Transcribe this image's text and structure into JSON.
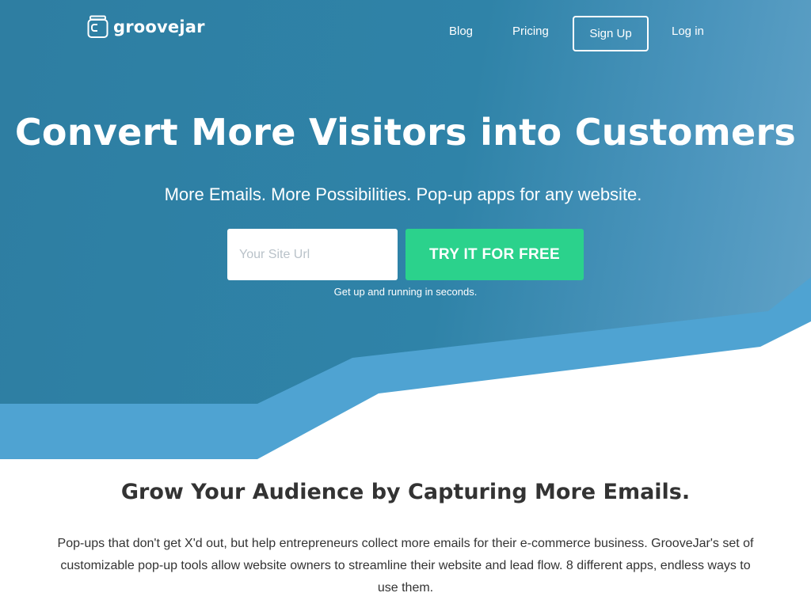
{
  "header": {
    "logo_text": "groovejar",
    "nav": {
      "blog": "Blog",
      "pricing": "Pricing",
      "signup": "Sign Up",
      "login": "Log in"
    }
  },
  "hero": {
    "title": "Convert More Visitors into Customers",
    "subtitle": "More Emails. More Possibilities. Pop-up apps for any website.",
    "url_placeholder": "Your Site Url",
    "url_value": "",
    "cta_label": "TRY IT FOR FREE",
    "hint": "Get up and running in seconds."
  },
  "section": {
    "heading": "Grow Your Audience by Capturing More Emails.",
    "body": "Pop-ups that don't get X'd out, but help entrepreneurs collect more emails for their e-commerce business. GrooveJar's set of customizable pop-up tools allow website owners to streamline their website and lead flow. 8 different apps, endless ways to use them."
  },
  "colors": {
    "hero_bg": "#2e7ea2",
    "wave_light": "#4fa3d2",
    "cta": "#2bd28c",
    "text_dark": "#333333"
  }
}
